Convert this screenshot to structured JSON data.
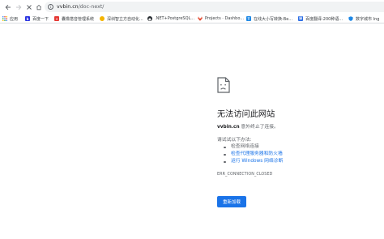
{
  "omnibox": {
    "host": "vvbin.cn",
    "path": "/doc-next/"
  },
  "bookmarks": [
    {
      "label": "应用",
      "icon": "apps-grid-icon",
      "color": "#5f6368"
    },
    {
      "label": "百度一下",
      "icon": "baidu-icon",
      "color": "#2932e1"
    },
    {
      "label": "囊橡搭音管理系统",
      "icon": "app-logo-icon",
      "color": "#e53935"
    },
    {
      "label": "深圳智立方自动化...",
      "icon": "site-logo-icon",
      "color": "#f4b400"
    },
    {
      "label": ".NET+PostgreSQL...",
      "icon": "github-icon",
      "color": "#24292e"
    },
    {
      "label": "Projects · Dashbo...",
      "icon": "gitlab-icon",
      "color": "#e24329"
    },
    {
      "label": "在线大小写转换-Be...",
      "icon": "tool-icon",
      "color": "#1e88e5"
    },
    {
      "label": "百度翻译-200种语...",
      "icon": "baidu-translate-icon",
      "color": "#2b6de5"
    },
    {
      "label": "数字城市 Ing",
      "icon": "shield-icon",
      "color": "#1e88e5"
    }
  ],
  "error": {
    "title": "无法访问此网站",
    "host": "vvbin.cn",
    "message": " 意外终止了连接。",
    "try_label": "请试试以下办法:",
    "suggestions": [
      {
        "text": "检查网络连接",
        "is_link": false
      },
      {
        "text": "检查代理服务器和防火墙",
        "is_link": true
      },
      {
        "text": "运行 Windows 网络诊断",
        "is_link": true
      }
    ],
    "code": "ERR_CONNECTION_CLOSED",
    "reload_label": "重新加载"
  }
}
